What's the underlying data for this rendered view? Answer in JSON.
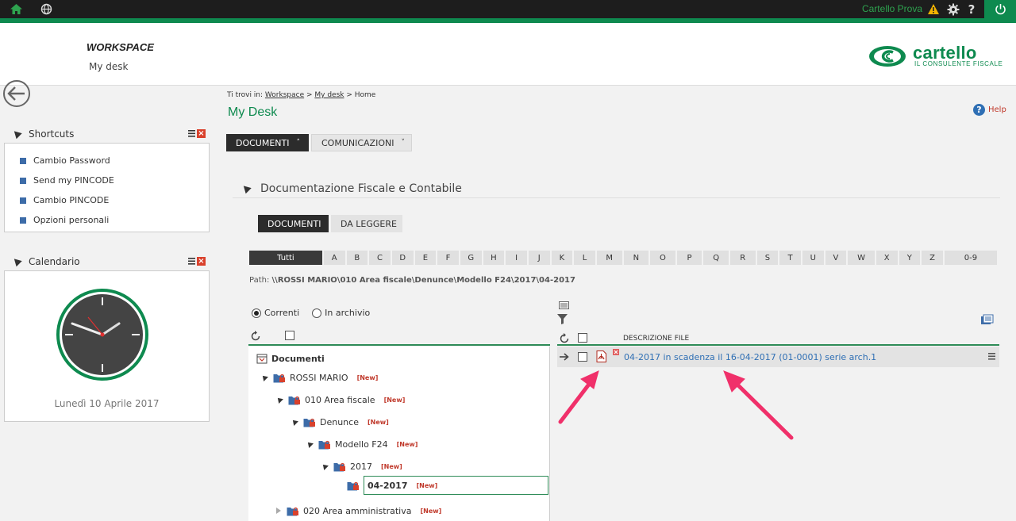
{
  "topbar": {
    "user_name": "Cartello Prova"
  },
  "header": {
    "title": "WORKSPACE",
    "subtitle": "My desk",
    "logo_word": "cartello",
    "logo_tagline": "IL CONSULENTE FISCALE"
  },
  "shortcuts": {
    "title": "Shortcuts",
    "items": [
      "Cambio Password",
      "Send my PINCODE",
      "Cambio PINCODE",
      "Opzioni personali"
    ]
  },
  "calendar": {
    "title": "Calendario",
    "date": "Lunedì 10 Aprile 2017"
  },
  "breadcrumb": {
    "prefix": "Ti trovi in:",
    "items": [
      "Workspace",
      "My desk",
      "Home"
    ]
  },
  "page": {
    "title": "My Desk",
    "help": "Help"
  },
  "tabs": {
    "documenti": "DOCUMENTI",
    "comunicazioni": "COMUNICAZIONI"
  },
  "section": {
    "title": "Documentazione Fiscale e Contabile",
    "subtabs": [
      "DOCUMENTI",
      "DA LEGGERE"
    ]
  },
  "alphabet": [
    "Tutti",
    "A",
    "B",
    "C",
    "D",
    "E",
    "F",
    "G",
    "H",
    "I",
    "J",
    "K",
    "L",
    "M",
    "N",
    "O",
    "P",
    "Q",
    "R",
    "S",
    "T",
    "U",
    "V",
    "W",
    "X",
    "Y",
    "Z",
    "0-9"
  ],
  "path": {
    "label": "Path:",
    "value": "\\\\ROSSI MARIO\\010 Area fiscale\\Denunce\\Modello F24\\2017\\04-2017"
  },
  "filters": {
    "correnti": "Correnti",
    "archivio": "In archivio"
  },
  "tree": {
    "root": "Documenti",
    "new_label": "[New]",
    "nodes": [
      "ROSSI MARIO",
      "010 Area fiscale",
      "Denunce",
      "Modello F24",
      "2017",
      "04-2017",
      "020 Area amministrativa"
    ]
  },
  "files": {
    "column": "DESCRIZIONE FILE",
    "rows": [
      {
        "name": "04-2017 in scadenza il 16-04-2017 (01-0001) serie arch.1"
      }
    ]
  },
  "colors": {
    "brand_green": "#0e8a4f",
    "link_blue": "#2f6fb4",
    "new_red": "#c0392b",
    "arrow_pink": "#f0306a"
  }
}
